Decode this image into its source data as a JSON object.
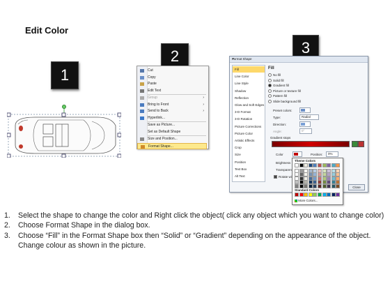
{
  "title": "Edit Color",
  "steps": [
    {
      "number": "1"
    },
    {
      "number": "2"
    },
    {
      "number": "3"
    }
  ],
  "context_menu": {
    "items": [
      {
        "label": "Cut",
        "icon": "scissors-icon",
        "arrow": "",
        "disabled": false,
        "highlight": false
      },
      {
        "label": "Copy",
        "icon": "copy-icon",
        "arrow": "",
        "disabled": false,
        "highlight": false
      },
      {
        "label": "Paste",
        "icon": "paste-icon",
        "arrow": "",
        "disabled": false,
        "highlight": false
      },
      {
        "label": "Edit Text",
        "icon": "edit-text-icon",
        "arrow": "",
        "disabled": false,
        "highlight": false
      },
      {
        "label": "Group",
        "icon": "group-icon",
        "arrow": "›",
        "disabled": true,
        "highlight": false
      },
      {
        "label": "Bring to Front",
        "icon": "bring-front-icon",
        "arrow": "›",
        "disabled": false,
        "highlight": false
      },
      {
        "label": "Send to Back",
        "icon": "send-back-icon",
        "arrow": "›",
        "disabled": false,
        "highlight": false
      },
      {
        "label": "Hyperlink...",
        "icon": "hyperlink-icon",
        "arrow": "",
        "disabled": false,
        "highlight": false
      },
      {
        "label": "Save as Picture...",
        "icon": "",
        "arrow": "",
        "disabled": false,
        "highlight": false
      },
      {
        "label": "Set as Default Shape",
        "icon": "",
        "arrow": "",
        "disabled": false,
        "highlight": false
      },
      {
        "label": "Size and Position...",
        "icon": "size-icon",
        "arrow": "",
        "disabled": false,
        "highlight": false
      },
      {
        "label": "Format Shape...",
        "icon": "format-shape-icon",
        "arrow": "",
        "disabled": false,
        "highlight": true
      }
    ]
  },
  "dialog": {
    "title": "Format Shape",
    "close": "✕",
    "categories": [
      "Fill",
      "Line Color",
      "Line Style",
      "Shadow",
      "Reflection",
      "Glow and Soft Edges",
      "3-D Format",
      "3-D Rotation",
      "Picture Corrections",
      "Picture Color",
      "Artistic Effects",
      "Crop",
      "Size",
      "Position",
      "Text Box",
      "Alt Text"
    ],
    "selected_category": "Fill",
    "section_title": "Fill",
    "fill_options": [
      "No fill",
      "Solid fill",
      "Gradient fill",
      "Picture or texture fill",
      "Pattern fill",
      "Slide background fill"
    ],
    "selected_fill": "Gradient fill",
    "preset_colors_label": "Preset colors:",
    "type_label": "Type:",
    "type_value": "Radial",
    "direction_label": "Direction:",
    "angle_label": "Angle:",
    "angle_value": "0°",
    "gradient_stops_label": "Gradient stops",
    "color_label": "Color",
    "position_label": "Position:",
    "position_value": "0%",
    "brightness_label": "Brightness",
    "transparency_label": "Transparency",
    "rotate_label": "Rotate with shape",
    "close_button": "Close"
  },
  "palette": {
    "theme_label": "Theme Colors",
    "standard_label": "Standard Colors",
    "more_label": "More Colors...",
    "theme_top": [
      "#ffffff",
      "#000000",
      "#eeece1",
      "#1f497d",
      "#4f81bd",
      "#c0504d",
      "#9bbb59",
      "#8064a2",
      "#4bacc6",
      "#f79646"
    ],
    "standard": [
      "#c00000",
      "#ff0000",
      "#ffc000",
      "#ffff00",
      "#92d050",
      "#00b050",
      "#00b0f0",
      "#0070c0",
      "#002060",
      "#7030a0"
    ]
  },
  "instructions": [
    {
      "num": "1.",
      "text": "Select the shape to change the color and Right click the object( click any object which you want to change color)"
    },
    {
      "num": "2.",
      "text": "Choose Format Shape in the dialog box."
    },
    {
      "num": "3.",
      "text": "Choose “Fill” in the Format Shape box then “Solid” or “Gradient” depending on the appearance of the object. Change colour as shown in the picture."
    }
  ]
}
